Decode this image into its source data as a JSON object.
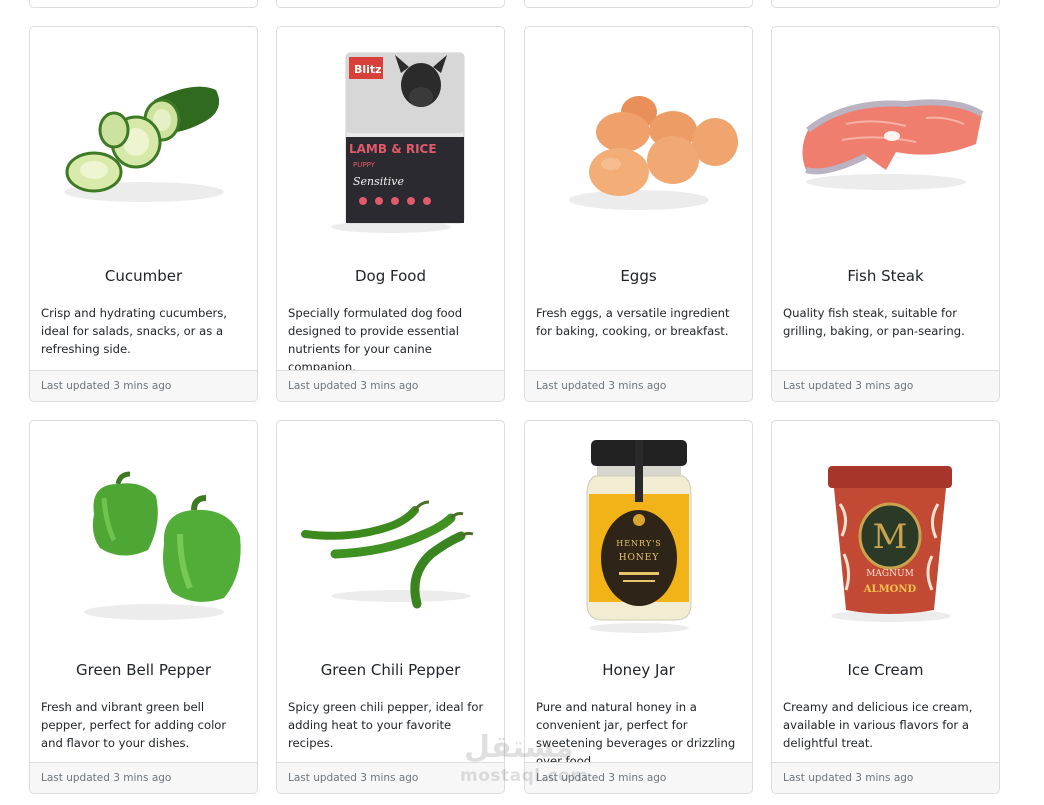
{
  "products": [
    {
      "id": "cucumber",
      "title": "Cucumber",
      "description": "Crisp and hydrating cucumbers, ideal for salads, snacks, or as a refreshing side.",
      "updated": "Last updated 3 mins ago",
      "icon": "cucumber-image"
    },
    {
      "id": "dog-food",
      "title": "Dog Food",
      "description": "Specially formulated dog food designed to provide essential nutrients for your canine companion.",
      "updated": "Last updated 3 mins ago",
      "icon": "dog-food-bag-image",
      "package_text": {
        "brand": "Blitz",
        "line1": "LAMB & RICE",
        "line2": "PUPPY",
        "line3": "Sensitive"
      }
    },
    {
      "id": "eggs",
      "title": "Eggs",
      "description": "Fresh eggs, a versatile ingredient for baking, cooking, or breakfast.",
      "updated": "Last updated 3 mins ago",
      "icon": "eggs-image"
    },
    {
      "id": "fish-steak",
      "title": "Fish Steak",
      "description": "Quality fish steak, suitable for grilling, baking, or pan-searing.",
      "updated": "Last updated 3 mins ago",
      "icon": "fish-steak-image"
    },
    {
      "id": "green-bell-pepper",
      "title": "Green Bell Pepper",
      "description": "Fresh and vibrant green bell pepper, perfect for adding color and flavor to your dishes.",
      "updated": "Last updated 3 mins ago",
      "icon": "bell-pepper-image"
    },
    {
      "id": "green-chili-pepper",
      "title": "Green Chili Pepper",
      "description": "Spicy green chili pepper, ideal for adding heat to your favorite recipes.",
      "updated": "Last updated 3 mins ago",
      "icon": "chili-pepper-image"
    },
    {
      "id": "honey-jar",
      "title": "Honey Jar",
      "description": "Pure and natural honey in a convenient jar, perfect for sweetening beverages or drizzling over food.",
      "updated": "Last updated 3 mins ago",
      "icon": "honey-jar-image",
      "label_text": {
        "line1": "HENRY'S",
        "line2": "HONEY"
      }
    },
    {
      "id": "ice-cream",
      "title": "Ice Cream",
      "description": "Creamy and delicious ice cream, available in various flavors for a delightful treat.",
      "updated": "Last updated 3 mins ago",
      "icon": "ice-cream-tub-image",
      "label_text": {
        "letter": "M",
        "brand": "MAGNUM",
        "flavor": "ALMOND"
      }
    }
  ],
  "watermark": {
    "arabic": "مستقل",
    "latin": "mostaql.com"
  },
  "colors": {
    "border": "#dcdcdc",
    "footer_bg": "#f7f7f7",
    "muted_text": "#6c757d"
  }
}
